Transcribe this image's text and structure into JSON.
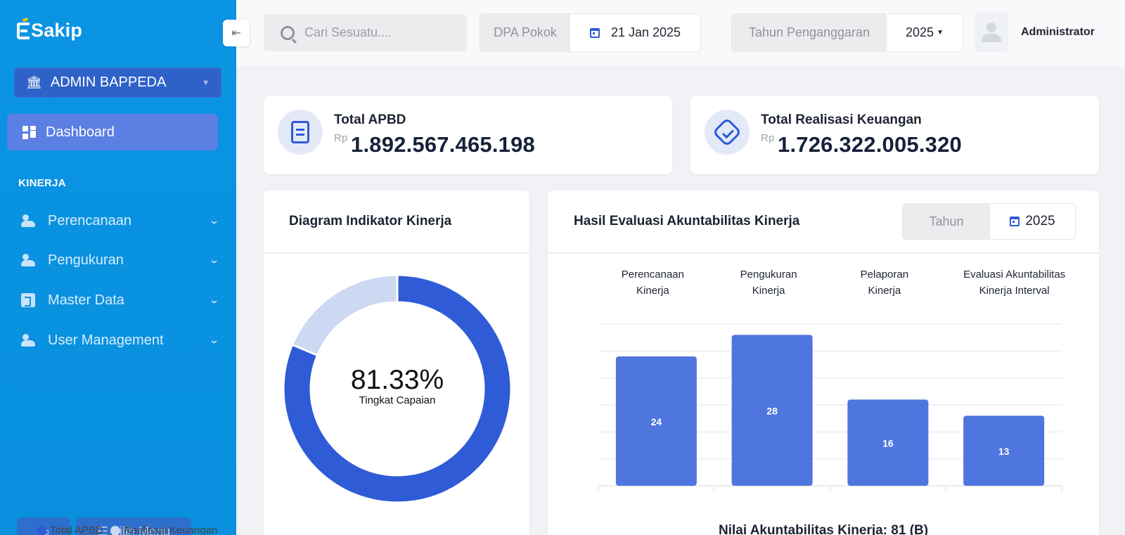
{
  "sidebar": {
    "logo": "Sakip",
    "org_select": "ADMIN BAPPEDA",
    "dashboard_label": "Dashboard",
    "section_label": "KINERJA",
    "items": [
      {
        "label": "Perencanaan",
        "icon": "users-icon"
      },
      {
        "label": "Pengukuran",
        "icon": "users-icon"
      },
      {
        "label": "Master Data",
        "icon": "database-icon"
      },
      {
        "label": "User Management",
        "icon": "users-icon"
      }
    ],
    "footer_menu_label": "Pilih Menu"
  },
  "header": {
    "search_placeholder": "Cari Sesuatu....",
    "dpa_label": "DPA Pokok",
    "dpa_date": "21 Jan 2025",
    "tahun_label": "Tahun Penganggaran",
    "tahun_value": "2025",
    "user_name": "Administrator"
  },
  "stats": {
    "apbd": {
      "title": "Total APBD",
      "currency": "Rp",
      "amount": "1.892.567.465.198"
    },
    "realisasi": {
      "title": "Total Realisasi Keuangan",
      "currency": "Rp",
      "amount": "1.726.322.005.320"
    }
  },
  "donut": {
    "title": "Diagram Indikator Kinerja",
    "percent_label": "81.33%",
    "caption": "Tingkat Capaian"
  },
  "bar_panel": {
    "title": "Hasil Evaluasi Akuntabilitas Kinerja",
    "filter_label": "Tahun",
    "filter_value": "2025",
    "footer": "Nilai Akuntabilitas Kinerja: 81 (B)"
  },
  "colors": {
    "primary": "#2f5bd6",
    "sidebar": "#0a94e3",
    "donut_main": "#2f5bd6",
    "donut_light": "#cdd8f3",
    "bar": "#4f76de"
  },
  "chart_data": [
    {
      "type": "pie",
      "categories": [
        "Total APBD",
        "Realisasi Keuangan"
      ],
      "values": [
        81.33,
        18.67
      ],
      "legend": "bottom"
    },
    {
      "type": "bar",
      "categories": [
        "Perencanaan Kinerja",
        "Pengukuran Kinerja",
        "Pelaporan Kinerja",
        "Evaluasi Akuntabilitas Kinerja Interval"
      ],
      "category_lines": [
        [
          "Perencanaan",
          "Kinerja"
        ],
        [
          "Pengukuran",
          "Kinerja"
        ],
        [
          "Pelaporan",
          "Kinerja"
        ],
        [
          "Evaluasi Akuntabilitas",
          "Kinerja Interval"
        ]
      ],
      "values": [
        24,
        28,
        16,
        13
      ],
      "ylim": [
        0,
        30
      ],
      "grid": true,
      "xaxis_position": "top"
    }
  ]
}
